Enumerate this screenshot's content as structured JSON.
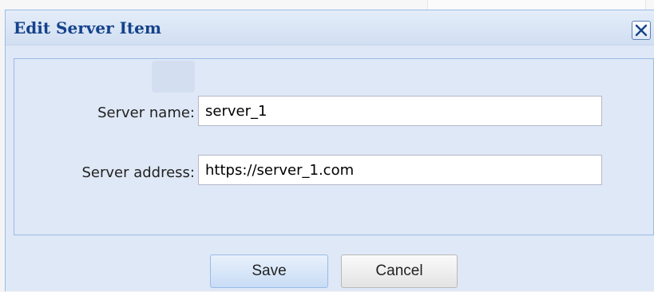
{
  "dialog": {
    "title": "Edit Server Item",
    "close_icon": "close-icon"
  },
  "form": {
    "name_label": "Server name:",
    "name_value": "server_1",
    "address_label": "Server address:",
    "address_value": "https://server_1.com"
  },
  "buttons": {
    "save_label": "Save",
    "cancel_label": "Cancel"
  },
  "colors": {
    "title_text": "#15428b",
    "dialog_bg": "#dfe8f6",
    "border": "#99bbe8"
  }
}
